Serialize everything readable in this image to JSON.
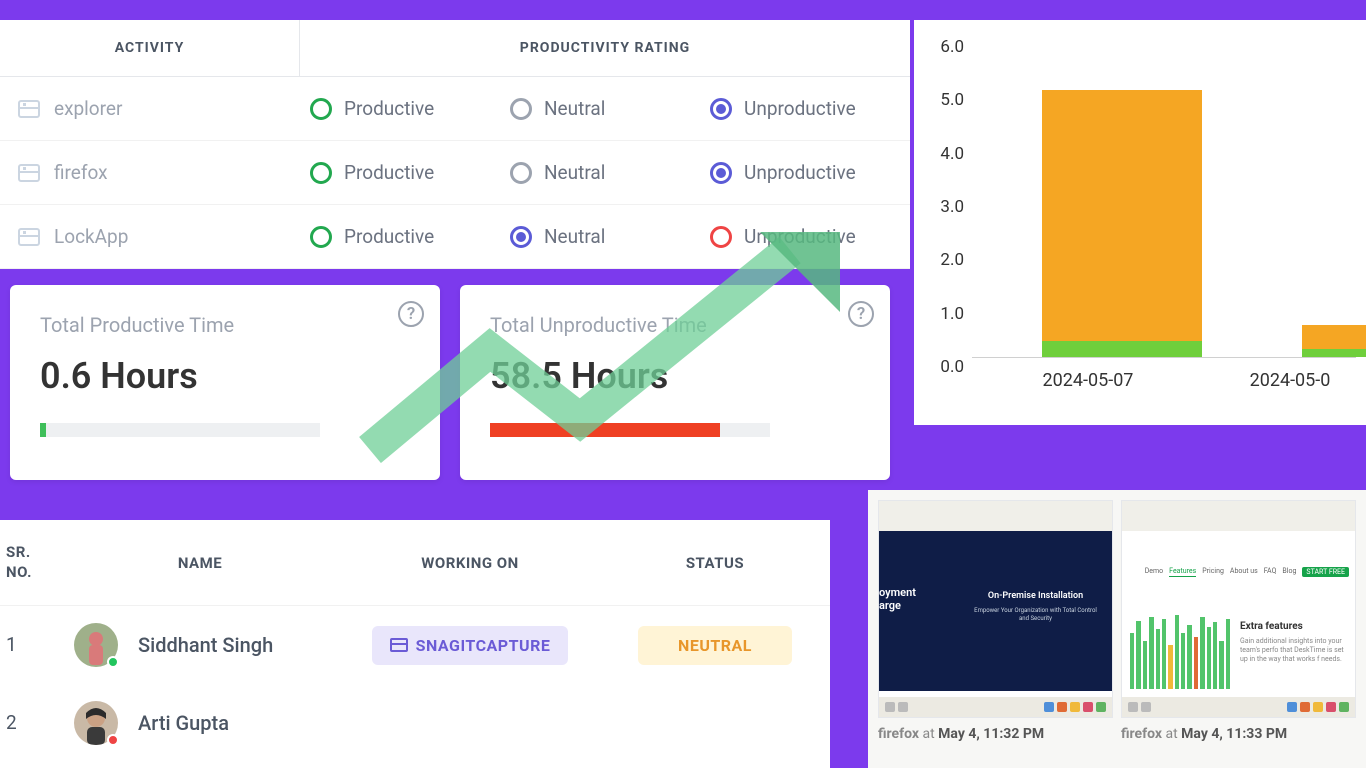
{
  "activity_table": {
    "header_activity": "ACTIVITY",
    "header_rating": "PRODUCTIVITY RATING",
    "rating_labels": {
      "productive": "Productive",
      "neutral": "Neutral",
      "unproductive": "Unproductive"
    },
    "rows": [
      {
        "app": "explorer",
        "selected": "unproductive"
      },
      {
        "app": "firefox",
        "selected": "unproductive"
      },
      {
        "app": "LockApp",
        "selected": "neutral"
      }
    ]
  },
  "time_cards": {
    "productive": {
      "label": "Total Productive Time",
      "value": "0.6 Hours"
    },
    "unproductive": {
      "label": "Total Unproductive Time",
      "value": "58.5 Hours"
    }
  },
  "chart_data": {
    "type": "bar",
    "stacked": true,
    "ylim": [
      0,
      6
    ],
    "y_ticks": [
      "0.0",
      "1.0",
      "2.0",
      "3.0",
      "4.0",
      "5.0",
      "6.0"
    ],
    "categories": [
      "2024-05-07",
      "2024-05-0"
    ],
    "series": [
      {
        "name": "green",
        "color": "#6fcf3c",
        "values": [
          0.3,
          0.15
        ]
      },
      {
        "name": "orange",
        "color": "#f5a623",
        "values": [
          4.7,
          0.45
        ]
      }
    ]
  },
  "employees": {
    "headers": {
      "sr": "SR. NO.",
      "name": "NAME",
      "working": "WORKING ON",
      "status": "STATUS"
    },
    "rows": [
      {
        "sr": "1",
        "name": "Siddhant Singh",
        "presence": "green",
        "working_on": "SNAGITCAPTURE",
        "status": "NEUTRAL"
      },
      {
        "sr": "2",
        "name": "Arti Gupta",
        "presence": "red",
        "working_on": "",
        "status": ""
      }
    ]
  },
  "screenshots": {
    "items": [
      {
        "app": "firefox",
        "at_word": "at",
        "time": "May 4, 11:32 PM",
        "dark_title": "On-Premise Installation",
        "dark_body": "Empower Your Organization with Total Control and Security",
        "left_word1": "oyment",
        "left_word2": "arge"
      },
      {
        "app": "firefox",
        "at_word": "at",
        "time": "May 4, 11:33 PM",
        "feature_title": "Extra features",
        "feature_body": "Gain additional insights into your team's perfo that DeskTime is set up in the way that works f needs.",
        "nav": [
          "Demo",
          "Features",
          "Pricing",
          "About us",
          "FAQ",
          "Blog"
        ],
        "nav_button": "START FREE"
      }
    ]
  }
}
